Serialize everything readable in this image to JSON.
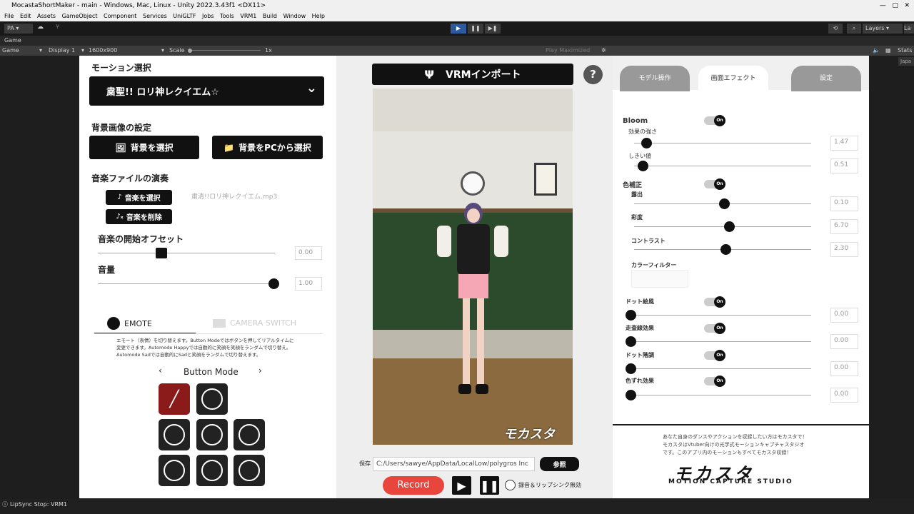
{
  "window": {
    "title": "MocastaShortMaker - main - Windows, Mac, Linux - Unity 2022.3.43f1 <DX11>"
  },
  "menu": [
    "File",
    "Edit",
    "Assets",
    "GameObject",
    "Component",
    "Services",
    "UniGLTF",
    "Jobs",
    "Tools",
    "VRM1",
    "Build",
    "Window",
    "Help"
  ],
  "toolbar": {
    "account": "PA",
    "layers": "Layers",
    "layout": "La"
  },
  "gametab": {
    "label": "Game",
    "stats": "Stats",
    "side": "Japa"
  },
  "gamebar": {
    "game": "Game",
    "display": "Display 1",
    "resolution": "1600x900",
    "scale_label": "Scale",
    "scale_value": "1x",
    "play_mode": "Play Maximized"
  },
  "left": {
    "motion_title": "モーション選択",
    "motion_value": "粛聖!! ロリ神レクイエム☆",
    "bg_title": "背景画像の設定",
    "bg_select": "背景を選択",
    "bg_pc": "背景をPCから選択",
    "music_title": "音楽ファイルの演奏",
    "music_select": "音楽を選択",
    "music_delete": "音楽を削除",
    "music_file": "粛清!!ロリ神レクイエム.mp3",
    "offset_title": "音楽の開始オフセット",
    "offset_value": "0.00",
    "offset_level": 0.36,
    "volume_title": "音量",
    "volume_value": "1.00",
    "volume_level": 1.0,
    "tab_emote": "EMOTE",
    "tab_camera": "CAMERA SWITCH",
    "desc1": "エモート（表情）を切り替えます。Button Modeではボタンを押してリアルタイムに",
    "desc2": "変更できます。Automode Happyでは自動的に笑顔を笑顔をランダムで切り替え。",
    "desc3": "Automode Sadでは自動的にSadと笑顔をランダムで切り替えます。",
    "mode": "Button Mode"
  },
  "center": {
    "vrm_button": "VRMインポート",
    "help": "?",
    "watermark": "モカスタ",
    "save_label": "保存",
    "save_path": "C:/Users/sawye/AppData/LocalLow/polygros Inc",
    "browse": "参照",
    "record": "Record",
    "checkbox_label": "録音＆リップシンク無効"
  },
  "right": {
    "tabs": [
      "モデル操作",
      "画面エフェクト",
      "設定"
    ],
    "bloom": "Bloom",
    "bloom_strength": "効果の強さ",
    "bloom_strength_val": "1.47",
    "bloom_strength_level": 0.07,
    "threshold": "しきい値",
    "threshold_val": "0.51",
    "threshold_level": 0.05,
    "color_corr": "色補正",
    "exposure": "露出",
    "exposure_val": "0.10",
    "exposure_level": 0.51,
    "saturation": "彩度",
    "saturation_val": "6.70",
    "saturation_level": 0.54,
    "contrast": "コントラスト",
    "contrast_val": "2.30",
    "contrast_level": 0.52,
    "color_filter": "カラーフィルター",
    "dot": "ドット絵風",
    "dot_val": "0.00",
    "dot_level": 0.0,
    "scan": "走査線効果",
    "scan_val": "0.00",
    "scan_level": 0.0,
    "dotgrad": "ドット階調",
    "dotgrad_val": "0.00",
    "dotgrad_level": 0.0,
    "shift": "色ずれ効果",
    "shift_val": "0.00",
    "shift_level": 0.0,
    "toggle_on": "On",
    "promo1": "あなた自身のダンスやアクションを収録したい方はモカスタで！",
    "promo2": "モカスタはVtuber向けの光学式モーションキャプチャスタジオ",
    "promo3": "です。このアプリ内のモーションもすべてモカスタ収録！",
    "logo": "モカスタ",
    "logo_sub": "MOTION CAPTURE STUDIO"
  },
  "status": "LipSync Stop: VRM1"
}
